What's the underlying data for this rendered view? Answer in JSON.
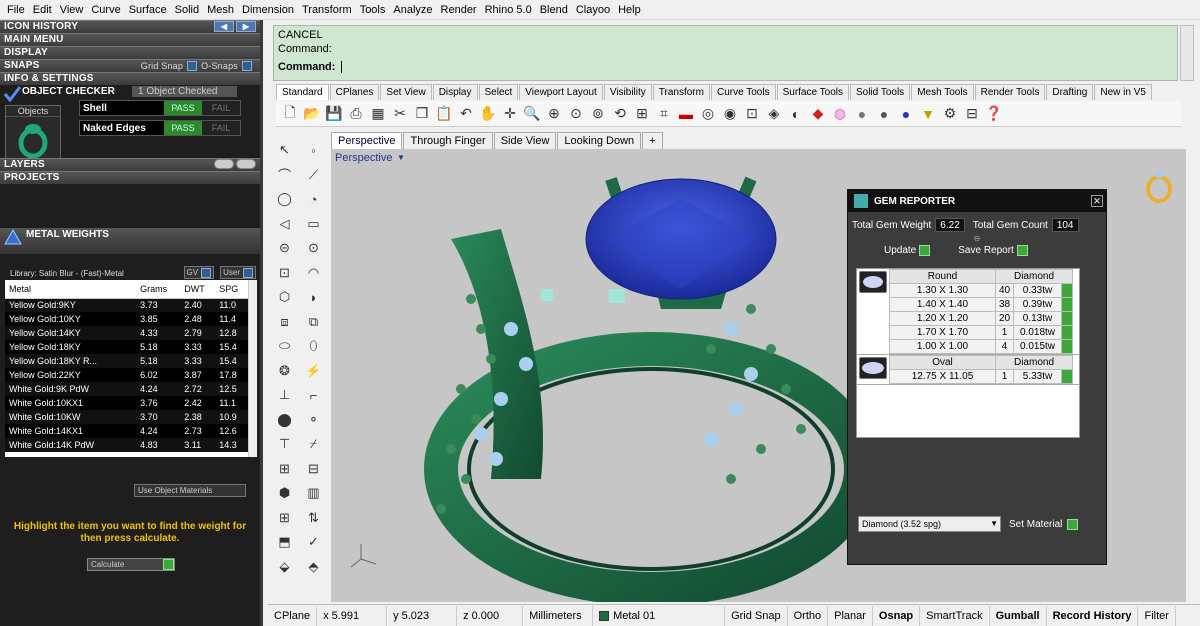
{
  "menu": [
    "File",
    "Edit",
    "View",
    "Curve",
    "Surface",
    "Solid",
    "Mesh",
    "Dimension",
    "Transform",
    "Tools",
    "Analyze",
    "Render",
    "Rhino 5.0",
    "Blend",
    "Clayoo",
    "Help"
  ],
  "left": {
    "sections": {
      "icon_history": "ICON HISTORY",
      "main_menu": "MAIN MENU",
      "display": "DISPLAY",
      "snaps": "SNAPS",
      "info_settings": "INFO & SETTINGS",
      "layers": "LAYERS",
      "projects": "PROJECTS"
    },
    "snaps": {
      "grid_snap": "Grid Snap",
      "osnaps": "O-Snaps"
    },
    "checker": {
      "title": "OBJECT CHECKER",
      "count": "1 Object Checked",
      "objects_label": "Objects",
      "rows": [
        {
          "name": "Shell",
          "pass": "PASS",
          "fail": "FAIL"
        },
        {
          "name": "Naked Edges",
          "pass": "PASS",
          "fail": "FAIL"
        }
      ]
    },
    "metal_weights": {
      "title": "METAL WEIGHTS",
      "library": "Library: Satin Blur - (Fast)-Metal",
      "gv": "GV",
      "user": "User",
      "headers": [
        "Metal",
        "Grams",
        "DWT",
        "SPG"
      ],
      "rows": [
        [
          "Yellow Gold:9KY",
          "3.73",
          "2.40",
          "11.0"
        ],
        [
          "Yellow Gold:10KY",
          "3.85",
          "2.48",
          "11.4"
        ],
        [
          "Yellow Gold:14KY",
          "4.33",
          "2.79",
          "12.8"
        ],
        [
          "Yellow Gold:18KY",
          "5.18",
          "3.33",
          "15.4"
        ],
        [
          "Yellow Gold:18KY R...",
          "5.18",
          "3.33",
          "15.4"
        ],
        [
          "Yellow Gold:22KY",
          "6.02",
          "3.87",
          "17.8"
        ],
        [
          "White Gold:9K PdW",
          "4.24",
          "2.72",
          "12.5"
        ],
        [
          "White Gold:10KX1",
          "3.76",
          "2.42",
          "11.1"
        ],
        [
          "White Gold:10KW",
          "3.70",
          "2.38",
          "10.9"
        ],
        [
          "White Gold:14KX1",
          "4.24",
          "2.73",
          "12.6"
        ],
        [
          "White Gold:14K PdW",
          "4.83",
          "3.11",
          "14.3"
        ]
      ],
      "use_materials": "Use Object Materials",
      "hint": "Highlight the item you want to find the weight for then press calculate.",
      "calculate": "Calculate"
    }
  },
  "command": {
    "line1": "CANCEL",
    "line2": "Command:",
    "prompt": "Command:"
  },
  "tabs": [
    "Standard",
    "CPlanes",
    "Set View",
    "Display",
    "Select",
    "Viewport Layout",
    "Visibility",
    "Transform",
    "Curve Tools",
    "Surface Tools",
    "Solid Tools",
    "Mesh Tools",
    "Render Tools",
    "Drafting",
    "New in V5"
  ],
  "viewport_tabs": [
    "Perspective",
    "Through Finger",
    "Side View",
    "Looking Down",
    "+"
  ],
  "viewport_label": "Perspective",
  "gem": {
    "title": "GEM REPORTER",
    "total_weight_label": "Total Gem Weight",
    "total_weight": "6.22",
    "total_count_label": "Total Gem Count",
    "total_count": "104",
    "update": "Update",
    "save": "Save Report",
    "round": {
      "shape": "Round",
      "material": "Diamond",
      "rows": [
        [
          "1.30 X 1.30",
          "40",
          "0.33tw"
        ],
        [
          "1.40 X 1.40",
          "38",
          "0.39tw"
        ],
        [
          "1.20 X 1.20",
          "20",
          "0.13tw"
        ],
        [
          "1.70 X 1.70",
          "1",
          "0.018tw"
        ],
        [
          "1.00 X 1.00",
          "4",
          "0.015tw"
        ]
      ]
    },
    "oval": {
      "shape": "Oval",
      "material": "Diamond",
      "rows": [
        [
          "12.75 X 11.05",
          "1",
          "5.33tw"
        ]
      ]
    },
    "material_select": "Diamond      (3.52 spg)",
    "set_material": "Set Material"
  },
  "status": {
    "cplane": "CPlane",
    "x": "x 5.991",
    "y": "y 5.023",
    "z": "z 0.000",
    "units": "Millimeters",
    "layer": "Metal 01",
    "items": [
      {
        "t": "Grid Snap",
        "b": false
      },
      {
        "t": "Ortho",
        "b": false
      },
      {
        "t": "Planar",
        "b": false
      },
      {
        "t": "Osnap",
        "b": true
      },
      {
        "t": "SmartTrack",
        "b": false
      },
      {
        "t": "Gumball",
        "b": true
      },
      {
        "t": "Record History",
        "b": true
      },
      {
        "t": "Filter",
        "b": false
      }
    ]
  },
  "colors": {
    "ring": "#1e6a46",
    "gem": "#2a3fc0",
    "panel": "#1e1e1e",
    "cmd": "#cfe6cf"
  }
}
